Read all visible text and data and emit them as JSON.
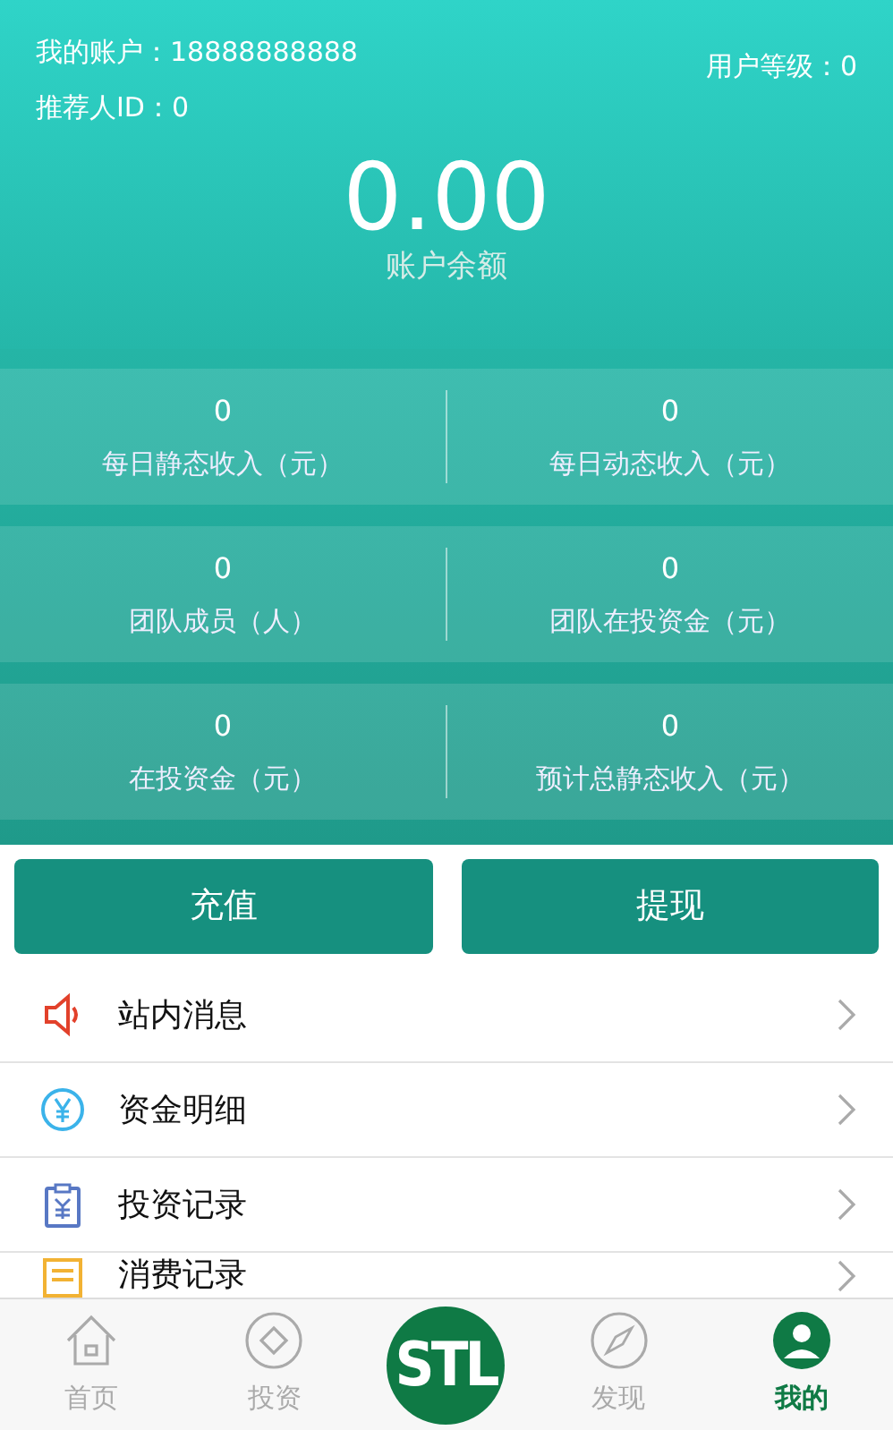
{
  "header": {
    "account_label": "我的账户：18888888888",
    "referrer_label": "推荐人ID：0",
    "level_label": "用户等级：0",
    "balance": "0.00",
    "balance_label": "账户余额"
  },
  "stats": [
    [
      {
        "value": "0",
        "label": "每日静态收入（元）"
      },
      {
        "value": "0",
        "label": "每日动态收入（元）"
      }
    ],
    [
      {
        "value": "0",
        "label": "团队成员（人）"
      },
      {
        "value": "0",
        "label": "团队在投资金（元）"
      }
    ],
    [
      {
        "value": "0",
        "label": "在投资金（元）"
      },
      {
        "value": "0",
        "label": "预计总静态收入（元）"
      }
    ]
  ],
  "buttons": [
    "充值",
    "提现"
  ],
  "menu": [
    {
      "kind": "speaker",
      "label": "站内消息"
    },
    {
      "kind": "yuan",
      "label": "资金明细"
    },
    {
      "kind": "clipboard",
      "label": "投资记录"
    },
    {
      "kind": "receipt",
      "label": "消费记录"
    }
  ],
  "tab_bar": {
    "logo": "STL",
    "tabs": [
      {
        "kind": "home",
        "label": "首页",
        "selected": false
      },
      {
        "kind": "invest",
        "label": "投资",
        "selected": false
      },
      {
        "kind": "discover",
        "label": "发现",
        "selected": false
      },
      {
        "kind": "profile",
        "label": "我的",
        "selected": true
      }
    ]
  }
}
